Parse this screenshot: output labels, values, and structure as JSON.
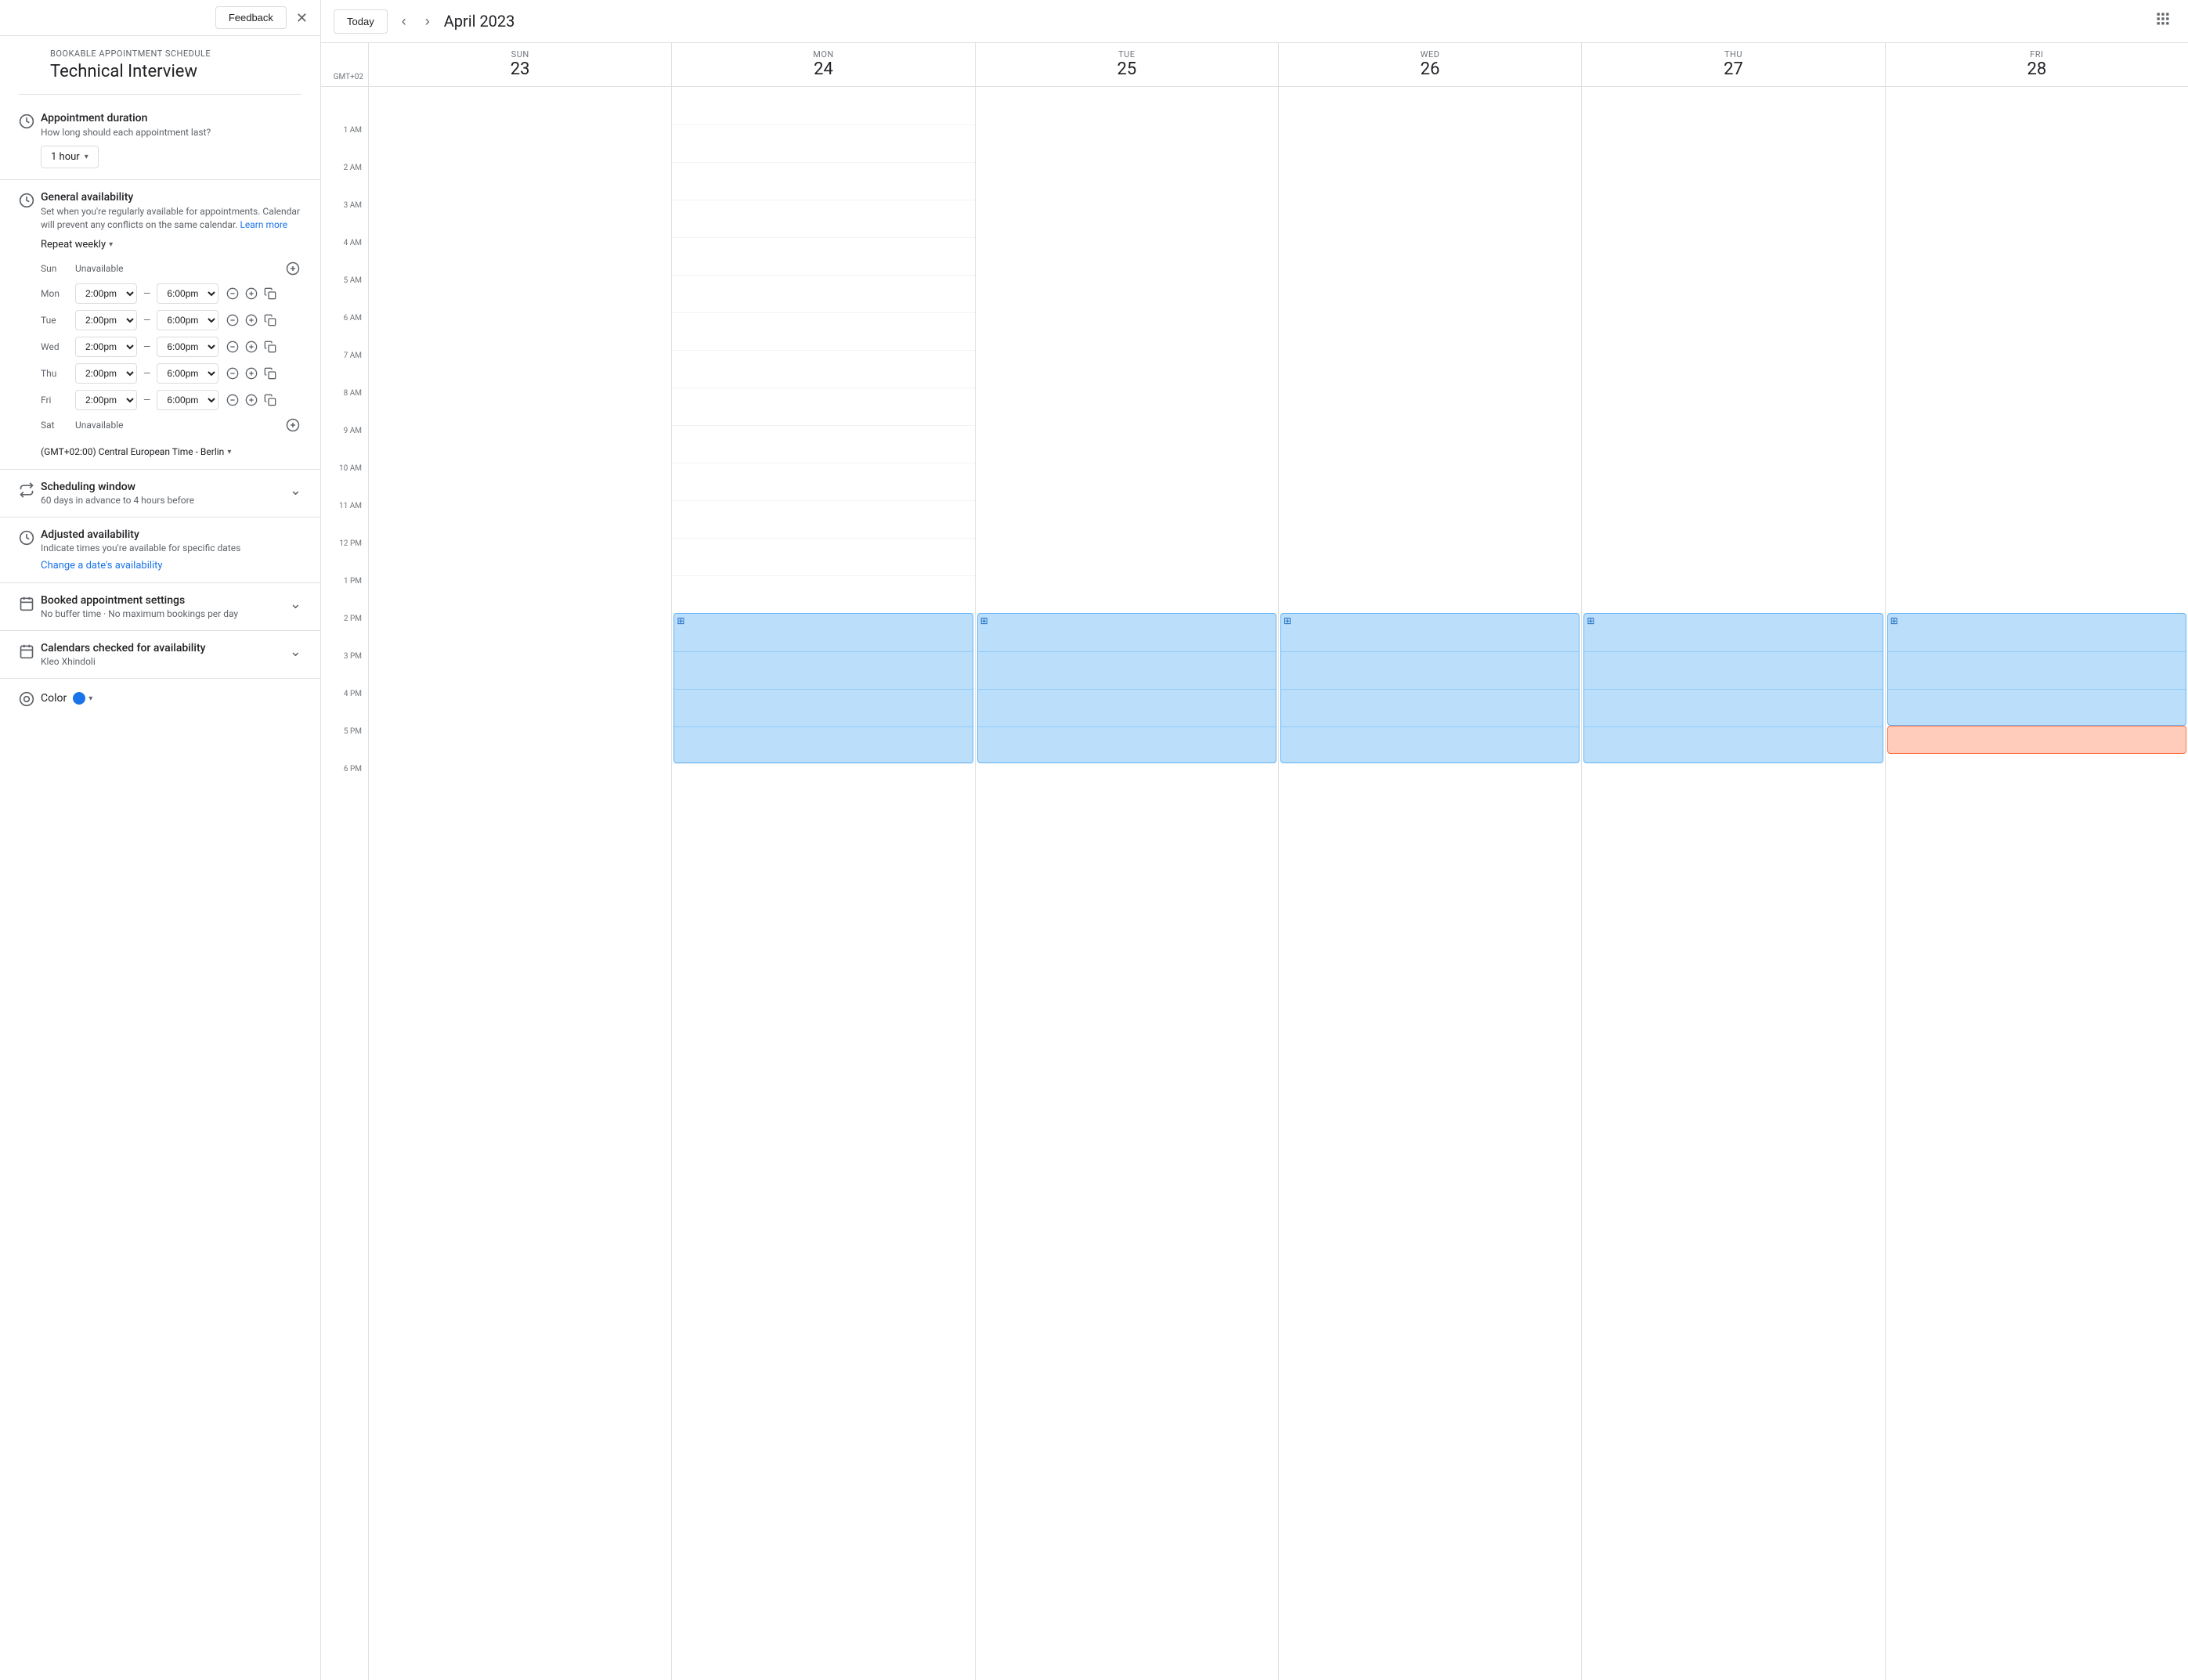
{
  "feedback": {
    "label": "Feedback"
  },
  "panel": {
    "bookable_label": "BOOKABLE APPOINTMENT SCHEDULE",
    "title": "Technical Interview",
    "appointment_duration": {
      "title": "Appointment duration",
      "subtitle": "How long should each appointment last?",
      "value": "1 hour"
    },
    "general_availability": {
      "title": "General availability",
      "subtitle": "Set when you're regularly available for appointments. Calendar will prevent any conflicts on the same calendar.",
      "learn_more": "Learn more",
      "repeat_label": "Repeat weekly",
      "days": [
        {
          "name": "Sun",
          "available": false,
          "start": "",
          "end": ""
        },
        {
          "name": "Mon",
          "available": true,
          "start": "2:00pm",
          "end": "6:00pm"
        },
        {
          "name": "Tue",
          "available": true,
          "start": "2:00pm",
          "end": "6:00pm"
        },
        {
          "name": "Wed",
          "available": true,
          "start": "2:00pm",
          "end": "6:00pm"
        },
        {
          "name": "Thu",
          "available": true,
          "start": "2:00pm",
          "end": "6:00pm"
        },
        {
          "name": "Fri",
          "available": true,
          "start": "2:00pm",
          "end": "6:00pm"
        },
        {
          "name": "Sat",
          "available": false,
          "start": "",
          "end": ""
        }
      ],
      "timezone": "(GMT+02:00) Central European Time - Berlin"
    },
    "scheduling_window": {
      "title": "Scheduling window",
      "subtitle": "60 days in advance to 4 hours before"
    },
    "adjusted_availability": {
      "title": "Adjusted availability",
      "subtitle": "Indicate times you're available for specific dates",
      "link": "Change a date's availability"
    },
    "booked_settings": {
      "title": "Booked appointment settings",
      "subtitle": "No buffer time · No maximum bookings per day"
    },
    "calendars": {
      "title": "Calendars checked for availability",
      "subtitle": "Kleo Xhindoli"
    },
    "color": {
      "label": "Color",
      "value": "#1a73e8"
    }
  },
  "calendar": {
    "today_label": "Today",
    "title": "April 2023",
    "timezone": "GMT+02",
    "days": [
      {
        "name": "SUN",
        "number": "23"
      },
      {
        "name": "MON",
        "number": "24"
      },
      {
        "name": "TUE",
        "number": "25"
      },
      {
        "name": "WED",
        "number": "26"
      },
      {
        "name": "THU",
        "number": "27"
      },
      {
        "name": "FRI",
        "number": "28"
      }
    ],
    "hours": [
      "",
      "1 AM",
      "2 AM",
      "3 AM",
      "4 AM",
      "5 AM",
      "6 AM",
      "7 AM",
      "8 AM",
      "9 AM",
      "10 AM",
      "11 AM",
      "12 PM",
      "1 PM",
      "2 PM",
      "3 PM",
      "4 PM",
      "5 PM",
      "6 PM"
    ]
  }
}
